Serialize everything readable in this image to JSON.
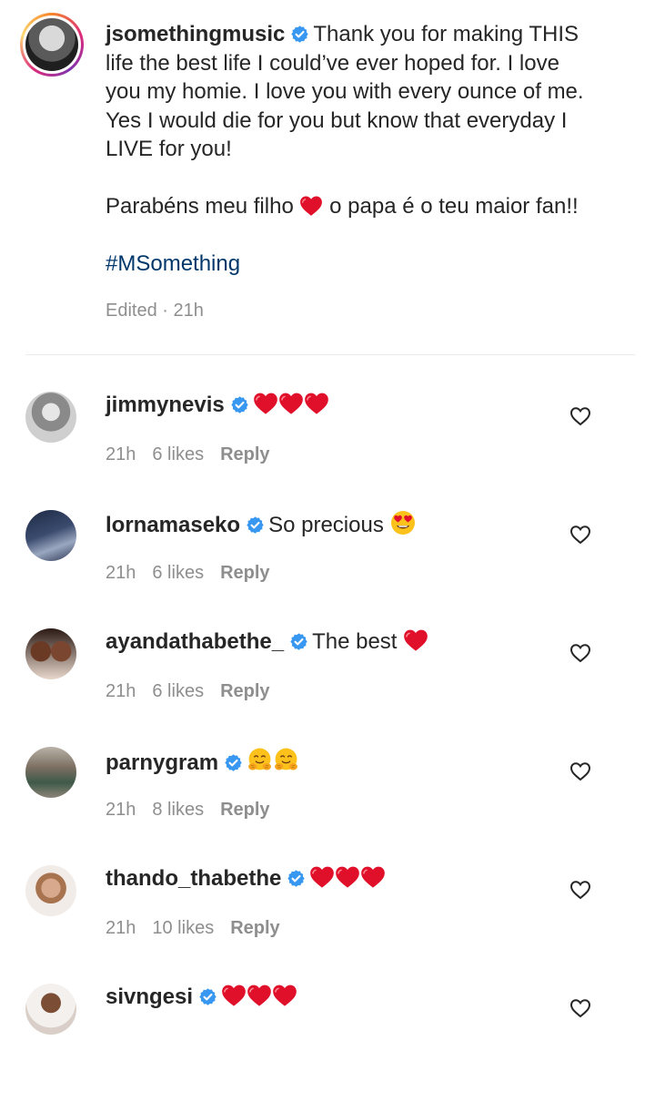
{
  "post": {
    "username": "jsomethingmusic",
    "caption_lines": [
      "Thank you for making THIS",
      "life the best life I could’ve ever hoped for. I love",
      "you my homie. I love you with every ounce of me.",
      "Yes I would die for you but know that everyday I",
      "LIVE for you!"
    ],
    "portuguese_before": "Parabéns meu filho",
    "portuguese_after": "o papa é o teu maior fan!!",
    "hashtag": "#MSomething",
    "meta": "Edited · 21h"
  },
  "colors": {
    "verified": "#3897f0",
    "heart": "#e0102a",
    "hashtag": "#00376b",
    "muted": "#8e8e8e"
  },
  "comments": [
    {
      "username": "jimmynevis",
      "text": "",
      "emoji": "heart-heart-heart",
      "time": "21h",
      "likes": "6 likes",
      "reply": "Reply"
    },
    {
      "username": "lornamaseko",
      "text": "So precious",
      "emoji": "heart-eyes",
      "time": "21h",
      "likes": "6 likes",
      "reply": "Reply"
    },
    {
      "username": "ayandathabethe_",
      "text": "The best",
      "emoji": "heart",
      "time": "21h",
      "likes": "6 likes",
      "reply": "Reply"
    },
    {
      "username": "parnygram",
      "text": "",
      "emoji": "hugging-hugging",
      "time": "21h",
      "likes": "8 likes",
      "reply": "Reply"
    },
    {
      "username": "thando_thabethe",
      "text": "",
      "emoji": "heart-heart-heart",
      "time": "21h",
      "likes": "10 likes",
      "reply": "Reply"
    },
    {
      "username": "sivngesi",
      "text": "",
      "emoji": "heart-heart-heart",
      "time": "",
      "likes": "",
      "reply": ""
    }
  ]
}
